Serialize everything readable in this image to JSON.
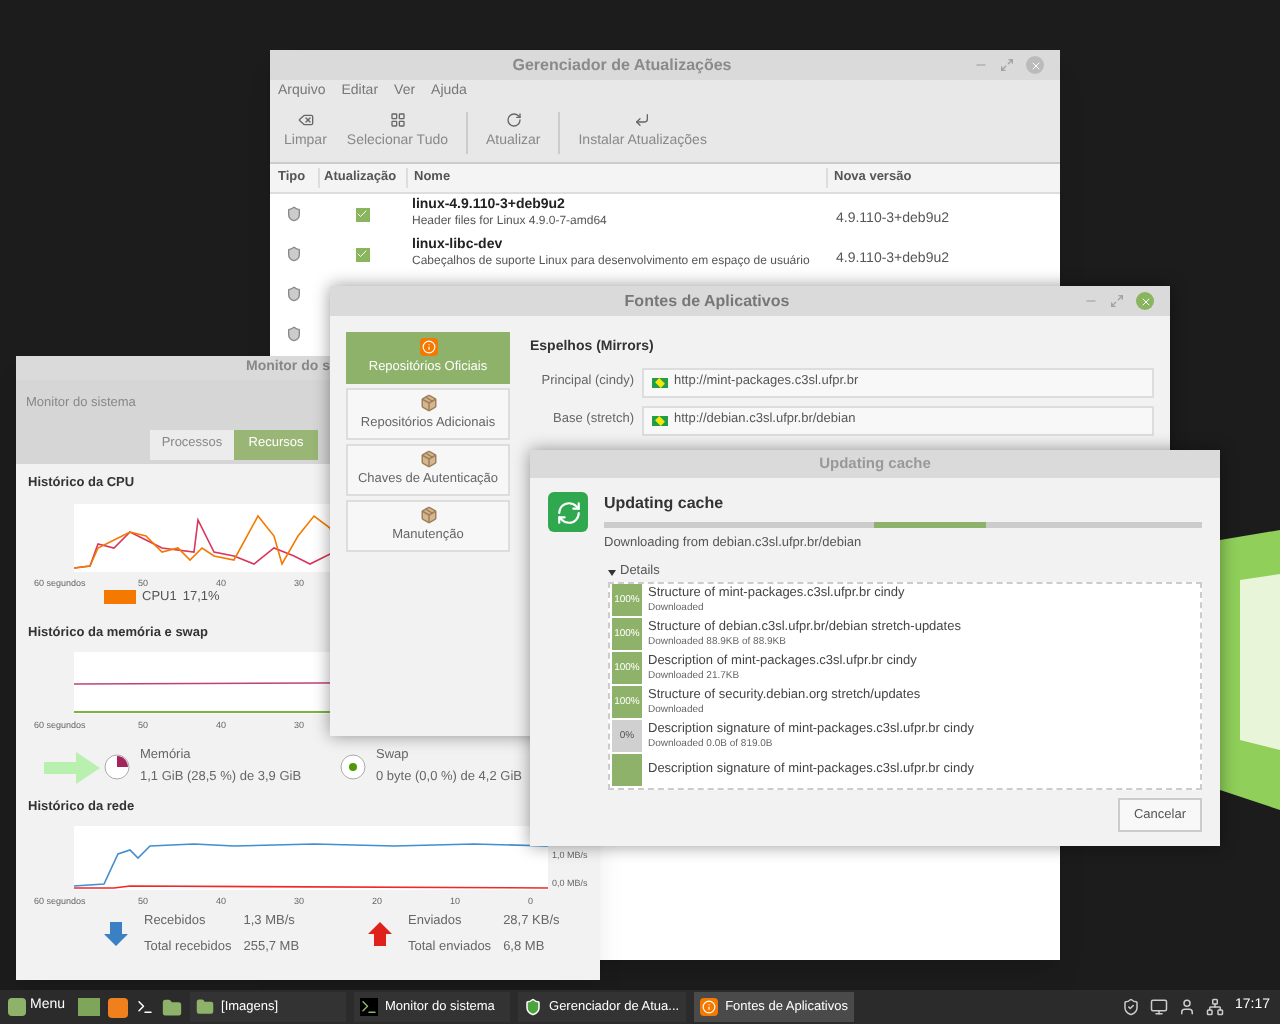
{
  "update_manager": {
    "title": "Gerenciador de Atualizações",
    "menu": [
      "Arquivo",
      "Editar",
      "Ver",
      "Ajuda"
    ],
    "toolbar": [
      "Limpar",
      "Selecionar Tudo",
      "Atualizar",
      "Instalar Atualizações"
    ],
    "columns": [
      "Tipo",
      "Atualização",
      "Nome",
      "Nova versão"
    ],
    "rows": [
      {
        "kind": "package",
        "checked": true,
        "name": "linux-4.9.110-3+deb9u2",
        "description": "Header files for Linux 4.9.0-7-amd64",
        "version": "4.9.110-3+deb9u2"
      },
      {
        "kind": "package",
        "checked": true,
        "name": "linux-libc-dev",
        "description": "Cabeçalhos de suporte Linux para desenvolvimento em espaço de usuário",
        "version": "4.9.110-3+deb9u2"
      },
      {
        "kind": "covered"
      },
      {
        "kind": "covered"
      }
    ]
  },
  "software_sources": {
    "title": "Fontes de Aplicativos",
    "sidebar": [
      {
        "label": "Repositórios Oficiais",
        "selected": true
      },
      {
        "label": "Repositórios Adicionais",
        "selected": false
      },
      {
        "label": "Chaves de Autenticação",
        "selected": false
      },
      {
        "label": "Manutenção",
        "selected": false
      }
    ],
    "mirrors_heading": "Espelhos (Mirrors)",
    "mirrors": [
      {
        "label": "Principal (cindy)",
        "value": "http://mint-packages.c3sl.ufpr.br"
      },
      {
        "label": "Base (stretch)",
        "value": "http://debian.c3sl.ufpr.br/debian"
      }
    ]
  },
  "updating_cache": {
    "title": "Updating cache",
    "heading": "Updating cache",
    "status": "Downloading from debian.c3sl.ufpr.br/debian",
    "details_label": "Details",
    "details_expanded": true,
    "items": [
      {
        "done": true,
        "percent": "100%",
        "title": "Structure of mint-packages.c3sl.ufpr.br cindy",
        "status": "Downloaded"
      },
      {
        "done": true,
        "percent": "100%",
        "title": "Structure of debian.c3sl.ufpr.br/debian stretch-updates",
        "status": "Downloaded 88.9KB of 88.9KB"
      },
      {
        "done": true,
        "percent": "100%",
        "title": "Description of mint-packages.c3sl.ufpr.br cindy",
        "status": "Downloaded 21.7KB"
      },
      {
        "done": true,
        "percent": "100%",
        "title": "Structure of security.debian.org stretch/updates",
        "status": "Downloaded"
      },
      {
        "done": false,
        "percent": "0%",
        "title": "Description signature of mint-packages.c3sl.ufpr.br cindy",
        "status": "Downloaded 0.0B of 819.0B"
      },
      {
        "done": true,
        "title": "Description signature of mint-packages.c3sl.ufpr.br cindy"
      }
    ],
    "cancel_button": "Cancelar"
  },
  "system_monitor": {
    "title": "Monitor do s",
    "header": "Monitor do sistema",
    "tabs": [
      {
        "label": "Processos",
        "selected": false
      },
      {
        "label": "Recursos",
        "selected": true
      }
    ],
    "cpu": {
      "heading": "Histórico da CPU",
      "x_labels": [
        "60 segundos",
        "50",
        "40",
        "30"
      ],
      "legend": [
        {
          "label": "CPU1",
          "value": "17,1%",
          "color": "#f57900"
        }
      ]
    },
    "memory": {
      "heading": "Histórico da memória e swap",
      "x_labels": [
        "60 segundos",
        "50",
        "40",
        "30"
      ],
      "memory_label": "Memória",
      "memory_value": "1,1 GiB (28,5 %) de 3,9 GiB",
      "swap_label": "Swap",
      "swap_value": "0 byte (0,0 %) de 4,2 GiB"
    },
    "network": {
      "heading": "Histórico da rede",
      "x_labels": [
        "60 segundos",
        "50",
        "40",
        "30",
        "20",
        "10",
        "0"
      ],
      "y_labels": [
        "1,0 MB/s",
        "0,0 MB/s"
      ],
      "received_label": "Recebidos",
      "received_value": "1,3 MB/s",
      "total_received_label": "Total recebidos",
      "total_received_value": "255,7 MB",
      "sent_label": "Enviados",
      "sent_value": "28,7 KB/s",
      "total_sent_label": "Total enviados",
      "total_sent_value": "6,8 MB"
    }
  },
  "taskbar": {
    "menu_label": "Menu",
    "items": [
      {
        "label": "[Imagens]",
        "selected": false
      },
      {
        "label": "Monitor do sistema",
        "selected": false
      },
      {
        "label": "Gerenciador de Atua...",
        "selected": false
      },
      {
        "label": "Fontes de Aplicativos",
        "selected": true
      }
    ],
    "clock": "17:17"
  }
}
